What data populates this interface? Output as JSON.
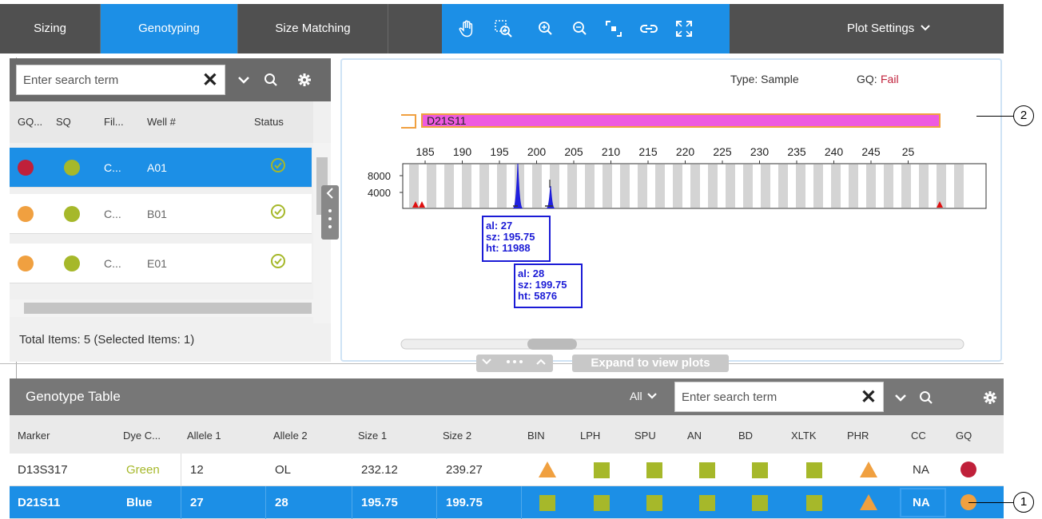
{
  "topbar": {
    "tabs": [
      {
        "label": "Sizing",
        "active": false
      },
      {
        "label": "Genotyping",
        "active": true
      },
      {
        "label": "Size Matching",
        "active": false
      }
    ],
    "tools": [
      "hand-pan-icon",
      "zoom-box-icon",
      "zoom-in-icon",
      "zoom-out-icon",
      "fit-icon",
      "link-icon",
      "expand-icon"
    ],
    "plot_settings_label": "Plot Settings"
  },
  "sample_panel": {
    "search_placeholder": "Enter search term",
    "columns": [
      "GQ...",
      "SQ",
      "Fil...",
      "Well #",
      "Status"
    ],
    "rows": [
      {
        "gq_color": "#c0203a",
        "sq_color": "#a6b82a",
        "file": "C...",
        "well": "A01",
        "selected": true
      },
      {
        "gq_color": "#f0a040",
        "sq_color": "#a6b82a",
        "file": "C...",
        "well": "B01",
        "selected": false
      },
      {
        "gq_color": "#f0a040",
        "sq_color": "#a6b82a",
        "file": "C...",
        "well": "E01",
        "selected": false
      }
    ],
    "total_label": "Total Items: 5 (Selected Items: 1)"
  },
  "plot": {
    "type_label": "Type: Sample",
    "gq_label": "GQ:",
    "gq_value": "Fail",
    "marker_name": "D21S11",
    "x_ticks": [
      "185",
      "190",
      "195",
      "200",
      "205",
      "210",
      "215",
      "220",
      "225",
      "230",
      "235",
      "240",
      "245",
      "25"
    ],
    "y_ticks": [
      "8000",
      "4000"
    ],
    "peak_labels": [
      {
        "al": "al: 27",
        "sz": "sz: 195.75",
        "ht": "ht: 11988"
      },
      {
        "al": "al: 28",
        "sz": "sz: 199.75",
        "ht": "ht: 5876"
      }
    ],
    "expand_label": "Expand to view plots"
  },
  "genotype_table": {
    "title": "Genotype Table",
    "filter_label": "All",
    "search_placeholder": "Enter search term",
    "columns": [
      "Marker",
      "Dye C...",
      "Allele 1",
      "Allele 2",
      "Size 1",
      "Size 2",
      "BIN",
      "LPH",
      "SPU",
      "AN",
      "BD",
      "XLTK",
      "PHR",
      "CC",
      "GQ"
    ],
    "rows": [
      {
        "marker": "D13S317",
        "dye": "Green",
        "allele1": "12",
        "allele2": "OL",
        "size1": "232.12",
        "size2": "239.27",
        "cc": "NA",
        "selected": false
      },
      {
        "marker": "D21S11",
        "dye": "Blue",
        "allele1": "27",
        "allele2": "28",
        "size1": "195.75",
        "size2": "199.75",
        "cc": "NA",
        "selected": true
      }
    ]
  },
  "callouts": [
    "1",
    "2"
  ],
  "colors": {
    "accent": "#1c8fe6",
    "fail": "#c0203a",
    "warn": "#f0a040",
    "pass": "#a6b82a",
    "peak": "#1b1bd6",
    "marker_bar": "#ee5ae0"
  }
}
